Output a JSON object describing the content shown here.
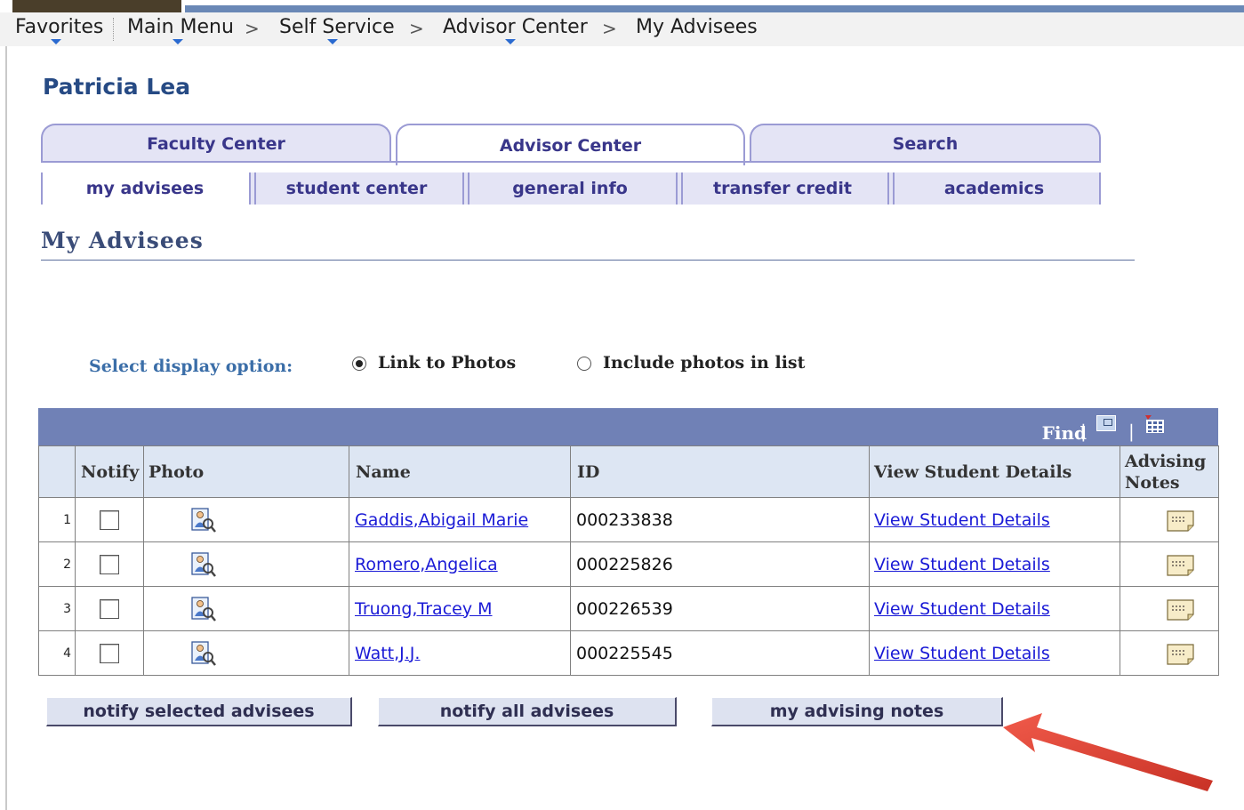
{
  "nav": {
    "favorites": "Favorites",
    "main_menu": "Main Menu",
    "self_service": "Self Service",
    "advisor_center": "Advisor Center",
    "current": "My Advisees",
    "separator": ">"
  },
  "user_name": "Patricia Lea",
  "tabs": [
    {
      "label": "Faculty Center"
    },
    {
      "label": "Advisor Center"
    },
    {
      "label": "Search"
    }
  ],
  "subtabs": [
    {
      "label": "my advisees"
    },
    {
      "label": "student center"
    },
    {
      "label": "general info"
    },
    {
      "label": "transfer credit"
    },
    {
      "label": "academics"
    }
  ],
  "page_title": "My Advisees",
  "display_option": {
    "label": "Select display option:",
    "options": [
      "Link to Photos",
      "Include photos in list"
    ],
    "selected": "Link to Photos"
  },
  "grid": {
    "find": "Find",
    "pipe": "|",
    "columns": {
      "notify": "Notify",
      "photo": "Photo",
      "name": "Name",
      "id": "ID",
      "details": "View Student Details",
      "notes_line1": "Advising",
      "notes_line2": "Notes"
    },
    "rows": [
      {
        "num": "1",
        "name": "Gaddis,Abigail Marie",
        "id": "000233838",
        "details": "View Student Details"
      },
      {
        "num": "2",
        "name": "Romero,Angelica",
        "id": "000225826",
        "details": "View Student Details"
      },
      {
        "num": "3",
        "name": "Truong,Tracey M",
        "id": "000226539",
        "details": "View Student Details"
      },
      {
        "num": "4",
        "name": "Watt,J.J.",
        "id": "000225545",
        "details": "View Student Details"
      }
    ]
  },
  "buttons": {
    "notify_selected": "notify selected advisees",
    "notify_all": "notify all advisees",
    "advising_notes": "my advising notes"
  },
  "colors": {
    "tab_text": "#39368a",
    "grid_header": "#7081b6",
    "link": "#1a1ad6",
    "arrow": "#e0443a"
  }
}
